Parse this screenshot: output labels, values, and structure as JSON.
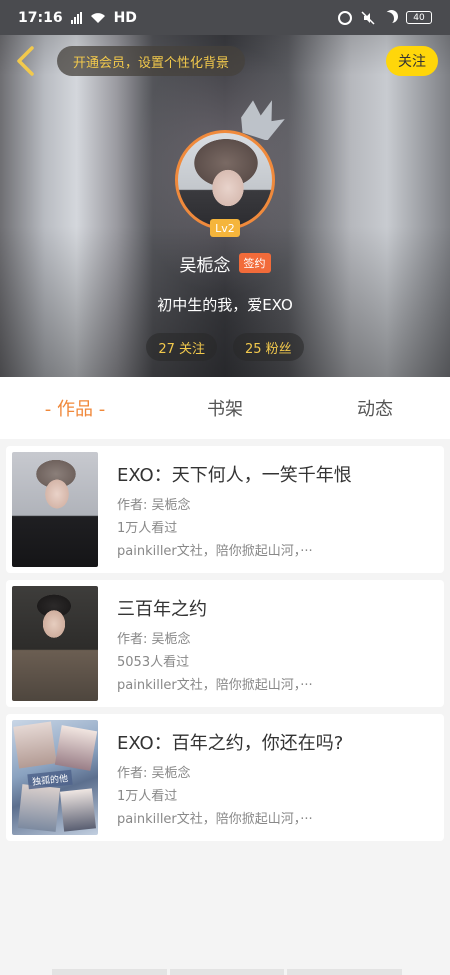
{
  "status_bar": {
    "time": "17:16",
    "network": "HD",
    "battery": "40"
  },
  "header": {
    "vip_banner": "开通会员，设置个性化背景",
    "follow_label": "关注",
    "level": "Lv2",
    "username": "吴栀念",
    "signed_badge": "签约",
    "bio": "初中生的我，爱EXO",
    "following_stat": "27 关注",
    "fans_stat": "25 粉丝",
    "accent_color": "#f08a3c"
  },
  "tabs": [
    {
      "label": "- 作品 -",
      "active": true
    },
    {
      "label": "书架",
      "active": false
    },
    {
      "label": "动态",
      "active": false
    }
  ],
  "works": [
    {
      "title": "EXO：天下何人，一笑千年恨",
      "author": "作者: 吴栀念",
      "views": "1万人看过",
      "tags": "painkiller文社，陪你掀起山河，···"
    },
    {
      "title": "三百年之约",
      "author": "作者: 吴栀念",
      "views": "5053人看过",
      "tags": "painkiller文社，陪你掀起山河，···"
    },
    {
      "title": "EXO：百年之约，你还在吗?",
      "author": "作者: 吴栀念",
      "views": "1万人看过",
      "tags": "painkiller文社，陪你掀起山河，···",
      "cover_text": "独孤的他"
    }
  ]
}
